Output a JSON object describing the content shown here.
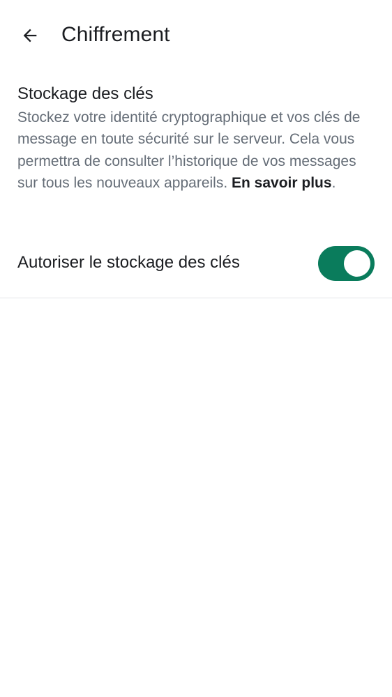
{
  "app_bar": {
    "back_icon": "arrow-left-icon",
    "title": "Chiffrement"
  },
  "key_storage": {
    "title": "Stockage des clés",
    "description": "Stockez votre identité cryptographique et vos clés de message en toute sécurité sur le serveur. Cela vous permettra de consulter l’historique de vos messages sur tous les nouveaux appareils. ",
    "learn_more": "En savoir plus",
    "period": "."
  },
  "allow_storage": {
    "label": "Autoriser le stockage des clés",
    "enabled": true
  },
  "colors": {
    "accent": "#0a7c5c",
    "text_primary": "#1b1d21",
    "text_secondary": "#656d77",
    "divider": "#e3e5e8"
  }
}
